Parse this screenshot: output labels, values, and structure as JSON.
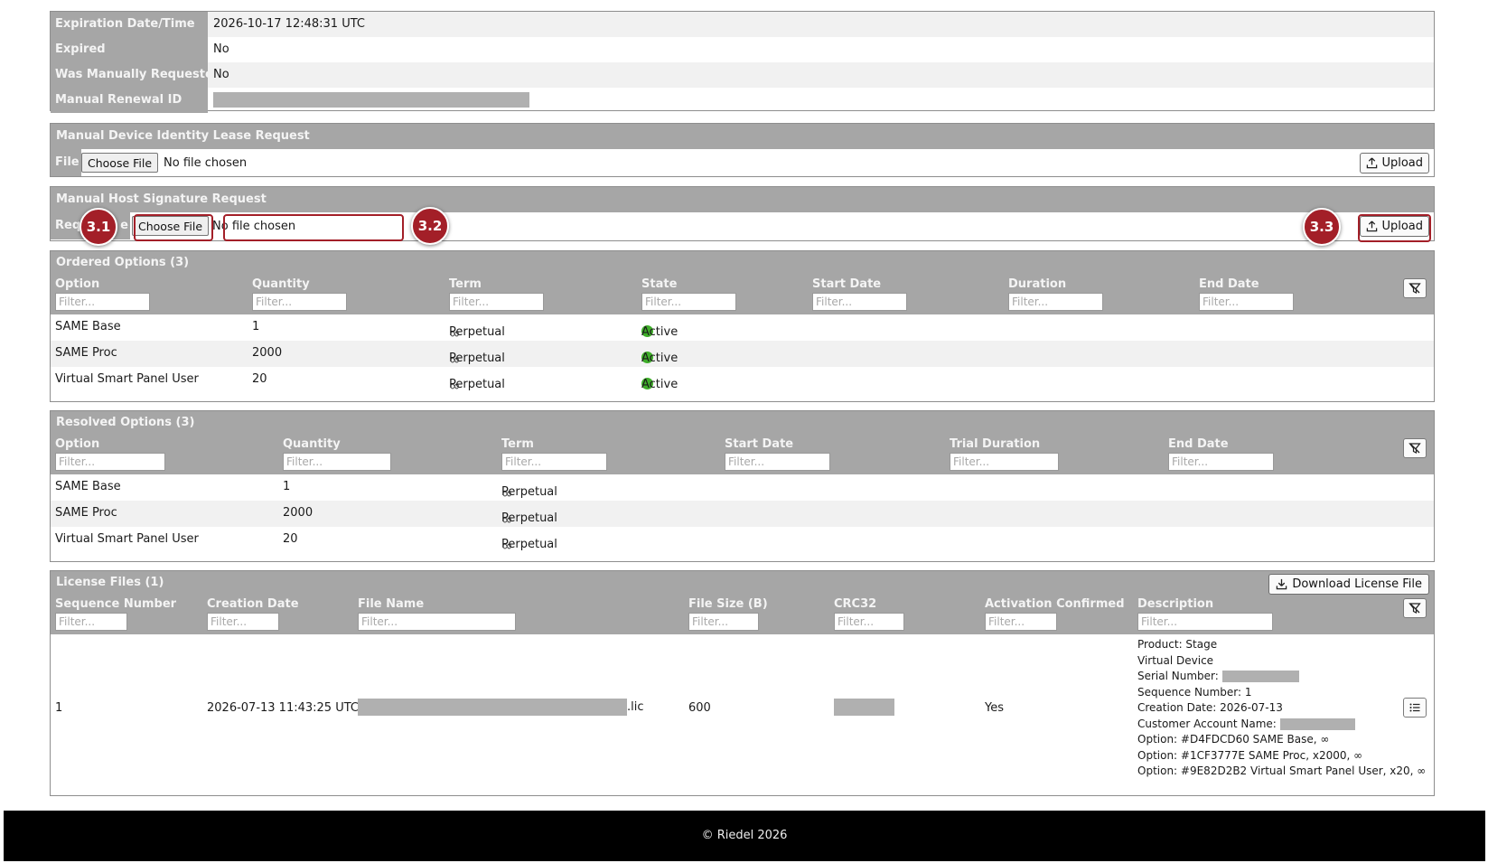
{
  "lease_info": {
    "rows": [
      {
        "key": "Expiration Date/Time",
        "value": "2026-10-17 12:48:31 UTC"
      },
      {
        "key": "Expired",
        "value": "No"
      },
      {
        "key": "Was Manually Requested",
        "value": "No"
      },
      {
        "key": "Manual Renewal ID",
        "value": ""
      }
    ]
  },
  "device_lease": {
    "title": "Manual Device Identity Lease Request",
    "file_label": "File",
    "choose_label": "Choose File",
    "no_file": "No file chosen",
    "upload_label": "Upload"
  },
  "host_signature": {
    "title": "Manual Host Signature Request",
    "label_start": "Req",
    "label_end": "e",
    "choose_label": "Choose File",
    "no_file": "No file chosen",
    "upload_label": "Upload"
  },
  "callouts": [
    "3.1",
    "3.2",
    "3.3"
  ],
  "ordered": {
    "title": "Ordered Options (3)",
    "columns": [
      "Option",
      "Quantity",
      "Term",
      "State",
      "Start Date",
      "Duration",
      "End Date"
    ],
    "filter_placeholder": "Filter...",
    "rows": [
      {
        "option": "SAME Base",
        "quantity": "1",
        "term": "Perpetual",
        "state": "Active"
      },
      {
        "option": "SAME Proc",
        "quantity": "2000",
        "term": "Perpetual",
        "state": "Active"
      },
      {
        "option": "Virtual Smart Panel User",
        "quantity": "20",
        "term": "Perpetual",
        "state": "Active"
      }
    ]
  },
  "resolved": {
    "title": "Resolved Options (3)",
    "columns": [
      "Option",
      "Quantity",
      "Term",
      "Start Date",
      "Trial Duration",
      "End Date"
    ],
    "filter_placeholder": "Filter...",
    "rows": [
      {
        "option": "SAME Base",
        "quantity": "1",
        "term": "Perpetual"
      },
      {
        "option": "SAME Proc",
        "quantity": "2000",
        "term": "Perpetual"
      },
      {
        "option": "Virtual Smart Panel User",
        "quantity": "20",
        "term": "Perpetual"
      }
    ]
  },
  "license_files": {
    "title": "License Files (1)",
    "download_label": "Download License File",
    "columns": [
      "Sequence Number",
      "Creation Date",
      "File Name",
      "File Size (B)",
      "CRC32",
      "Activation Confirmed",
      "Description"
    ],
    "filter_placeholder": "Filter...",
    "row": {
      "sequence": "1",
      "creation_date": "2026-07-13 11:43:25 UTC",
      "file_ext": ".lic",
      "file_size": "600",
      "activation": "Yes",
      "description": [
        "Product: Stage",
        "Virtual Device",
        "Serial Number:",
        "Sequence Number: 1",
        "Creation Date: 2026-07-13",
        "Customer Account Name:",
        "Option: #D4FDCD60 SAME Base, ∞",
        "Option: #1CF3777E SAME Proc, x2000, ∞",
        "Option: #9E82D2B2 Virtual Smart Panel User, x20, ∞"
      ]
    }
  },
  "footer": "© Riedel 2026",
  "colors": {
    "accent": "#a31f28",
    "header": "#a6a6a6",
    "active": "#3fae2a"
  }
}
